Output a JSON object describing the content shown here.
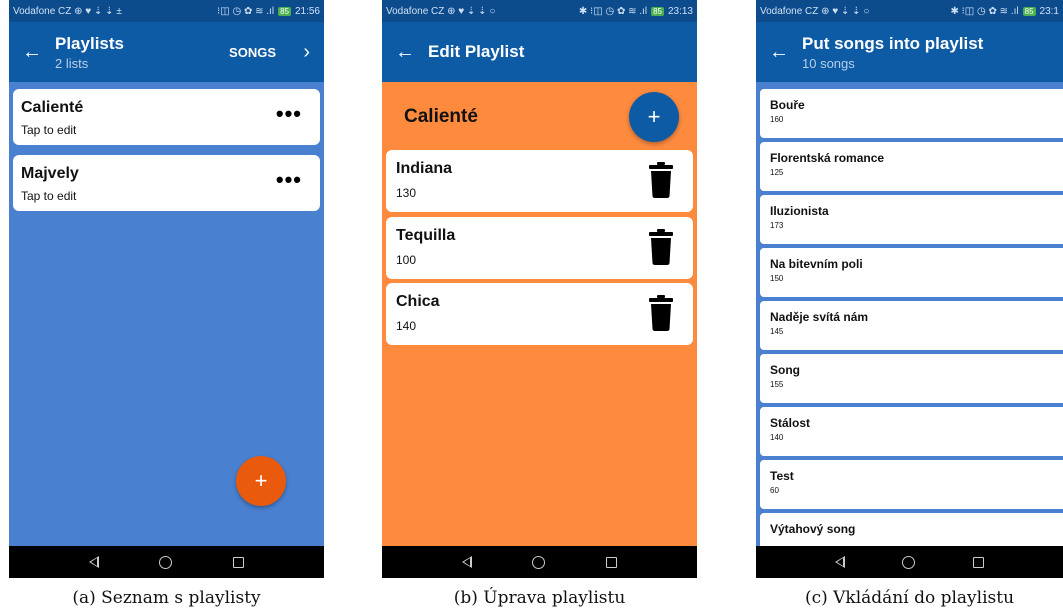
{
  "screens": [
    {
      "status": {
        "left": "Vodafone CZ ⊕ ♥ ⇣ ⇣ ±",
        "right": "⁝◫ ◷ ✿ ≋ .ıl",
        "battery": "85",
        "time": "21:56"
      },
      "appbar": {
        "title": "Playlists",
        "subtitle": "2 lists",
        "action": "SONGS"
      },
      "playlists": [
        {
          "name": "Calienté",
          "hint": "Tap to edit"
        },
        {
          "name": "Majvely",
          "hint": "Tap to edit"
        }
      ],
      "fab": "+",
      "caption": "(a) Seznam s playlisty"
    },
    {
      "status": {
        "left": "Vodafone CZ ⊕ ♥ ⇣ ⇣ ○",
        "right": "✱ ⁝◫ ◷ ✿ ≋ .ıl",
        "battery": "85",
        "time": "23:13"
      },
      "appbar": {
        "title": "Edit Playlist"
      },
      "playlist_name": "Calienté",
      "fab": "+",
      "songs": [
        {
          "name": "Indiana",
          "bpm": "130"
        },
        {
          "name": "Tequilla",
          "bpm": "100"
        },
        {
          "name": "Chica",
          "bpm": "140"
        }
      ],
      "caption": "(b) Úprava playlistu"
    },
    {
      "status": {
        "left": "Vodafone CZ ⊕ ♥ ⇣ ⇣ ○",
        "right": "✱ ⁝◫ ◷ ✿ ≋ .ıl",
        "battery": "85",
        "time": "23:1"
      },
      "appbar": {
        "title": "Put songs into playlist",
        "subtitle": "10 songs"
      },
      "songs": [
        {
          "name": "Bouře",
          "bpm": "160"
        },
        {
          "name": "Florentská romance",
          "bpm": "125"
        },
        {
          "name": "Iluzionista",
          "bpm": "173"
        },
        {
          "name": "Na bitevním poli",
          "bpm": "150"
        },
        {
          "name": "Naděje svítá nám",
          "bpm": "145"
        },
        {
          "name": "Song",
          "bpm": "155"
        },
        {
          "name": "Stálost",
          "bpm": "140"
        },
        {
          "name": "Test",
          "bpm": "60"
        },
        {
          "name": "Výtahový song",
          "bpm": ""
        }
      ],
      "caption": "(c) Vkládání do playlistu"
    }
  ],
  "colors": {
    "appbar": "#0d5aa5",
    "statusbar": "#0d4c8c",
    "blue_bg": "#4a80d0",
    "orange_bg": "#fe8a3e",
    "fab_orange": "#e95a0c"
  },
  "icons": {
    "back": "arrow-left-icon",
    "next": "chevron-right-icon",
    "more": "more-horizontal-icon",
    "add": "plus-icon",
    "delete": "trash-icon"
  }
}
